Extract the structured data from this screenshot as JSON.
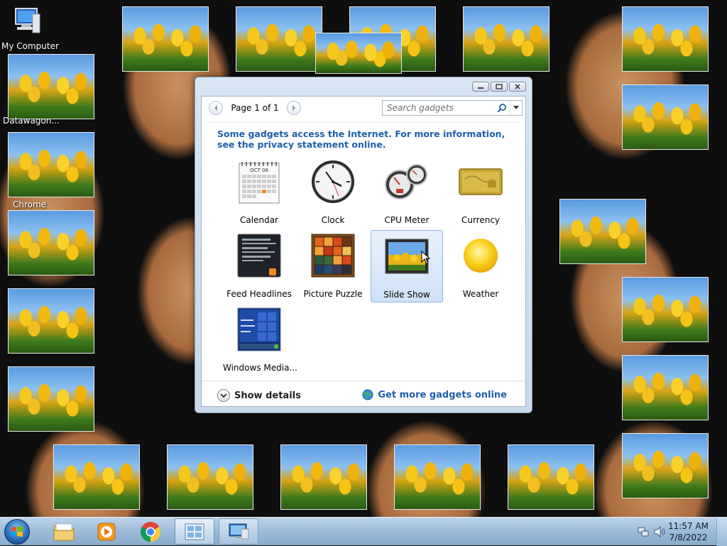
{
  "desktop": {
    "icons": [
      {
        "label": "My Computer"
      },
      {
        "label": "Datawagon..."
      },
      {
        "label": "Chrome"
      }
    ]
  },
  "gadget_window": {
    "pager": {
      "text": "Page 1 of 1"
    },
    "search": {
      "placeholder": "Search gadgets",
      "value": ""
    },
    "notice": "Some gadgets access the Internet.  For more information, see the privacy statement online.",
    "gadgets": [
      {
        "label": "Calendar",
        "icon": "calendar-icon",
        "selected": false
      },
      {
        "label": "Clock",
        "icon": "clock-icon",
        "selected": false
      },
      {
        "label": "CPU Meter",
        "icon": "cpu-meter-icon",
        "selected": false
      },
      {
        "label": "Currency",
        "icon": "currency-icon",
        "selected": false
      },
      {
        "label": "Feed Headlines",
        "icon": "feed-headlines-icon",
        "selected": false
      },
      {
        "label": "Picture Puzzle",
        "icon": "picture-puzzle-icon",
        "selected": false
      },
      {
        "label": "Slide Show",
        "icon": "slide-show-icon",
        "selected": true
      },
      {
        "label": "Weather",
        "icon": "weather-icon",
        "selected": false
      },
      {
        "label": "Windows Media...",
        "icon": "windows-media-icon",
        "selected": false
      }
    ],
    "show_details": "Show details",
    "get_more": "Get more gadgets online",
    "calendar_month": "OCT 08"
  },
  "taskbar": {
    "clock_time": "11:57 AM",
    "clock_date": "7/8/2022",
    "buttons": [
      "start-button",
      "file-explorer",
      "media-player",
      "chrome",
      "gadgets",
      "remote-desktop"
    ]
  },
  "colors": {
    "link_blue": "#1d5fa9",
    "selection": "#cfe2f8",
    "taskbar": "#9fbcd9"
  }
}
